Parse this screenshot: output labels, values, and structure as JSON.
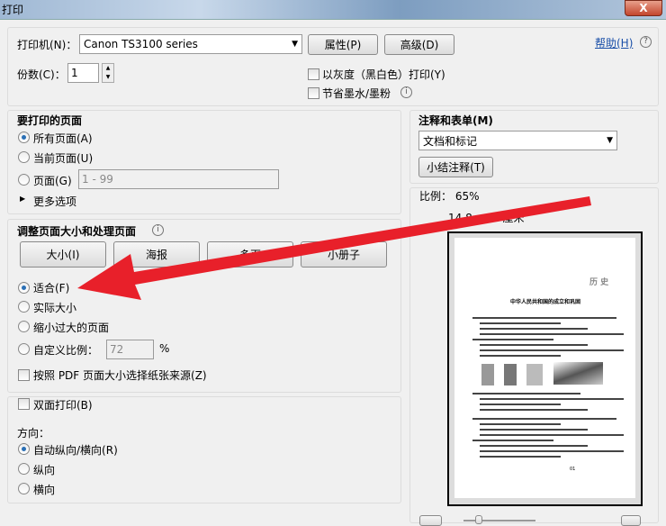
{
  "window": {
    "title": "打印",
    "close": "X"
  },
  "top": {
    "printer_label": "打印机(N)：",
    "printer_value": "Canon TS3100 series",
    "properties": "属性(P)",
    "advanced": "高级(D)",
    "help": "帮助(H)",
    "help_icon": "?",
    "copies_label": "份数(C)：",
    "copies_value": "1",
    "grayscale": "以灰度（黑白色）打印(Y)",
    "save_ink": "节省墨水/墨粉"
  },
  "pages": {
    "title": "要打印的页面",
    "all": "所有页面(A)",
    "current": "当前页面(U)",
    "pages": "页面(G)",
    "range_placeholder": "1 - 99",
    "more": "更多选项"
  },
  "sizing": {
    "title": "调整页面大小和处理页面",
    "tabs": [
      "大小(I)",
      "海报",
      "多页",
      "小册子"
    ],
    "fit": "适合(F)",
    "actual": "实际大小",
    "shrink": "缩小过大的页面",
    "custom": "自定义比例：",
    "custom_value": "72",
    "percent": "%",
    "pdf_source": "按照 PDF 页面大小选择纸张来源(Z)"
  },
  "duplex": {
    "label": "双面打印(B)",
    "orientation": "方向：",
    "auto": "自动纵向/横向(R)",
    "portrait": "纵向",
    "landscape": "横向"
  },
  "comments": {
    "title": "注释和表单(M)",
    "value": "文档和标记",
    "summarize": "小结注释(T)"
  },
  "preview": {
    "scale": "比例： 65%",
    "size": "14.8 x 21 厘米",
    "doc_subject": "历 史",
    "doc_title": "中华人民共和国的成立和巩固",
    "page_no": "01"
  },
  "annotation": {
    "arrow_color": "#e8202a"
  }
}
